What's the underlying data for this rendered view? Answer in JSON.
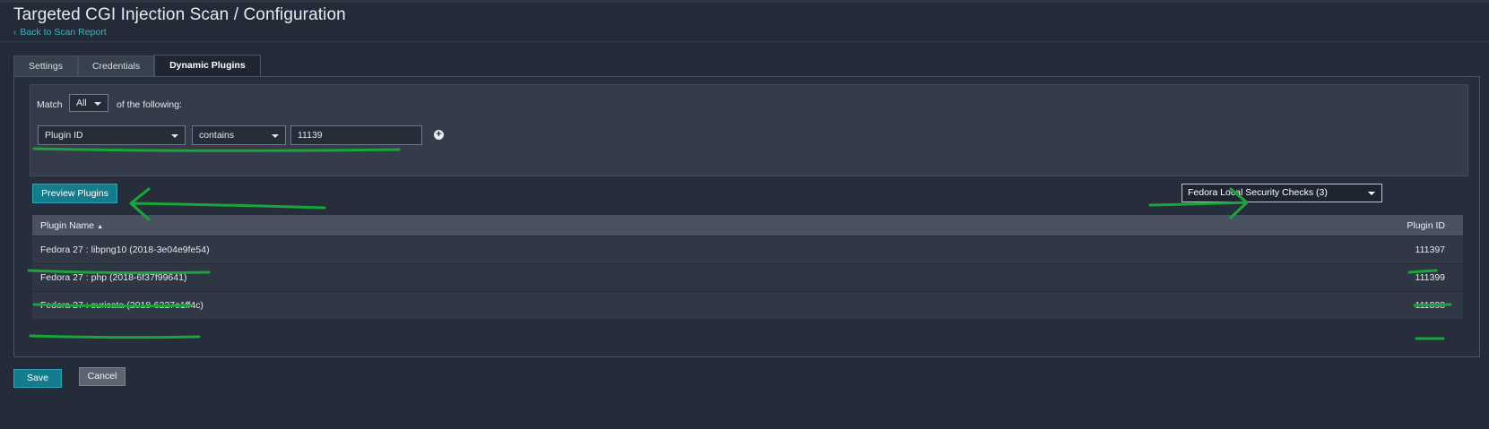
{
  "colors": {
    "background": "#232b38",
    "accent_button": "#157c8e",
    "link": "#3cb2c8",
    "annotation": "#1aa53a"
  },
  "header": {
    "title": "Targeted CGI Injection Scan / Configuration",
    "back_icon": "chevron-left-icon",
    "back_link": "Back to Scan Report"
  },
  "tabs": [
    {
      "label": "Settings",
      "active": false
    },
    {
      "label": "Credentials",
      "active": false
    },
    {
      "label": "Dynamic Plugins",
      "active": true
    }
  ],
  "filter": {
    "match_label": "Match",
    "match_value": "All",
    "following_label": "of the following:",
    "rule": {
      "field": "Plugin ID",
      "operator": "contains",
      "value": "11139"
    },
    "add_icon": "plus-circle-icon"
  },
  "actions": {
    "preview_label": "Preview Plugins",
    "family_select": "Fedora Local Security Checks (3)"
  },
  "table": {
    "columns": [
      "Plugin Name",
      "Plugin ID"
    ],
    "sort_indicator": "▲",
    "rows": [
      {
        "name": "Fedora 27 : libpng10 (2018-3e04e9fe54)",
        "id": "111397"
      },
      {
        "name": "Fedora 27 : php (2018-6f37f99641)",
        "id": "111399"
      },
      {
        "name": "Fedora 27 : suricata (2018-6227e1ff4c)",
        "id": "111398"
      }
    ]
  },
  "footer": {
    "save_label": "Save",
    "cancel_label": "Cancel"
  }
}
